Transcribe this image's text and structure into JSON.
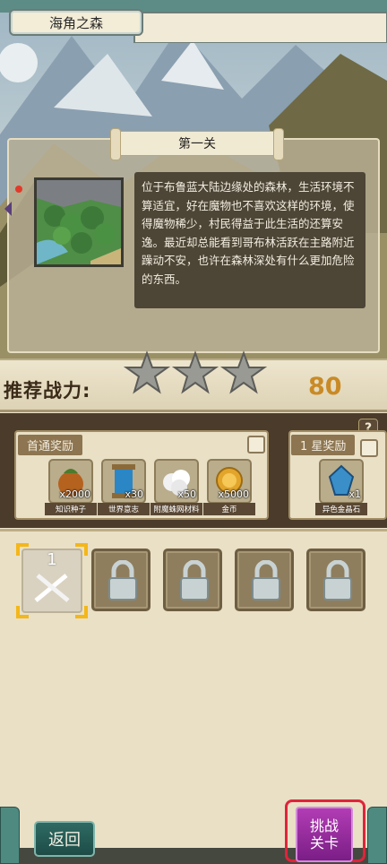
{
  "header": {
    "title": "海角之森"
  },
  "stage": {
    "name": "第一关",
    "description": "位于布鲁蓝大陆边缘处的森林，生活环境不算适宜，好在魔物也不喜欢这样的环境，使得魔物稀少，村民得益于此生活的还算安逸。最近却总能看到哥布林活跃在主路附近躁动不安，也许在森林深处有什么更加危险的东西。"
  },
  "power": {
    "label": "推荐战力:",
    "value": "80",
    "stars_earned": 0,
    "stars_total": 3
  },
  "rewards": {
    "help": "?",
    "first_clear": {
      "title": "首通奖励",
      "items": [
        {
          "name": "知识种子",
          "count": "x2000",
          "icon": "seed-pod-icon"
        },
        {
          "name": "世界意志",
          "count": "x30",
          "icon": "blue-scroll-icon"
        },
        {
          "name": "附魔蛛网材料",
          "count": "x50",
          "icon": "cotton-web-icon"
        },
        {
          "name": "金币",
          "count": "x5000",
          "icon": "gold-coin-icon"
        }
      ]
    },
    "one_star": {
      "title": "1 星奖励",
      "items": [
        {
          "name": "异色金晶石",
          "count": "x1",
          "icon": "blue-crystal-icon"
        }
      ]
    }
  },
  "slots": [
    {
      "state": "selected",
      "label": "1",
      "icon": "crossed-swords-icon"
    },
    {
      "state": "locked",
      "icon": "lock-icon"
    },
    {
      "state": "locked",
      "icon": "lock-icon"
    },
    {
      "state": "locked",
      "icon": "lock-icon"
    },
    {
      "state": "locked",
      "icon": "lock-icon"
    }
  ],
  "buttons": {
    "back": "返回",
    "challenge_line1": "挑战",
    "challenge_line2": "关卡"
  },
  "colors": {
    "power_value": "#c98a25",
    "challenge": "#9a2ea0",
    "highlight": "#e0243b",
    "selection": "#f4b719"
  }
}
